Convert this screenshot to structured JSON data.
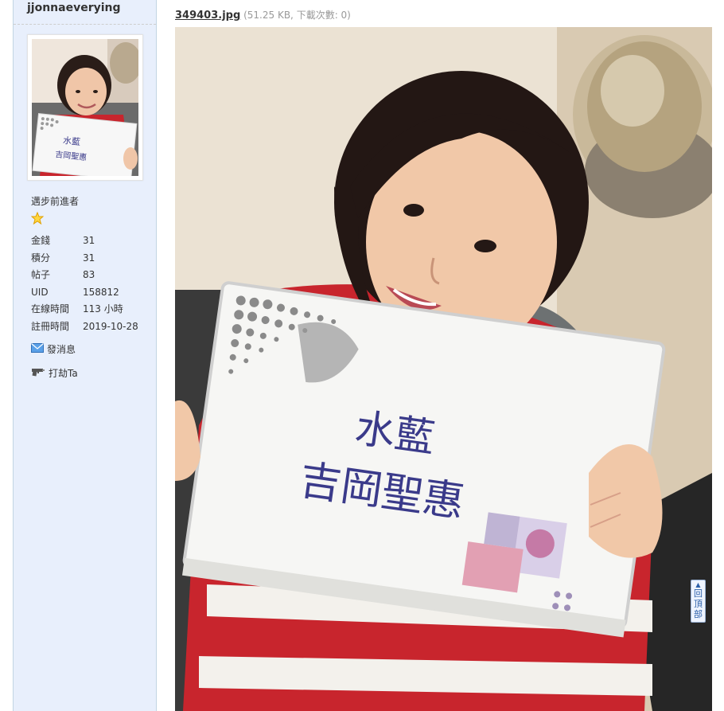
{
  "user": {
    "username": "jjonnaeverying",
    "rank": "邁步前進者",
    "stats": [
      {
        "label": "金錢",
        "value": "31"
      },
      {
        "label": "積分",
        "value": "31"
      },
      {
        "label": "帖子",
        "value": "83"
      },
      {
        "label": "UID",
        "value": "158812"
      },
      {
        "label": "在線時間",
        "value": "113 小時"
      },
      {
        "label": "註冊時間",
        "value": "2019-10-28"
      }
    ],
    "actions": {
      "send_message": "發消息",
      "hit_ta": "打劫Ta"
    }
  },
  "attachment": {
    "filename": "349403.jpg",
    "meta": "(51.25 KB, 下載次數: 0)"
  },
  "photo_sign": {
    "line1": "水藍",
    "line2": "吉岡聖惠"
  },
  "back_to_top": "回頂部",
  "colors": {
    "sidebar_bg": "#e8effc",
    "shirt_red": "#c8252d",
    "link": "#333333"
  }
}
